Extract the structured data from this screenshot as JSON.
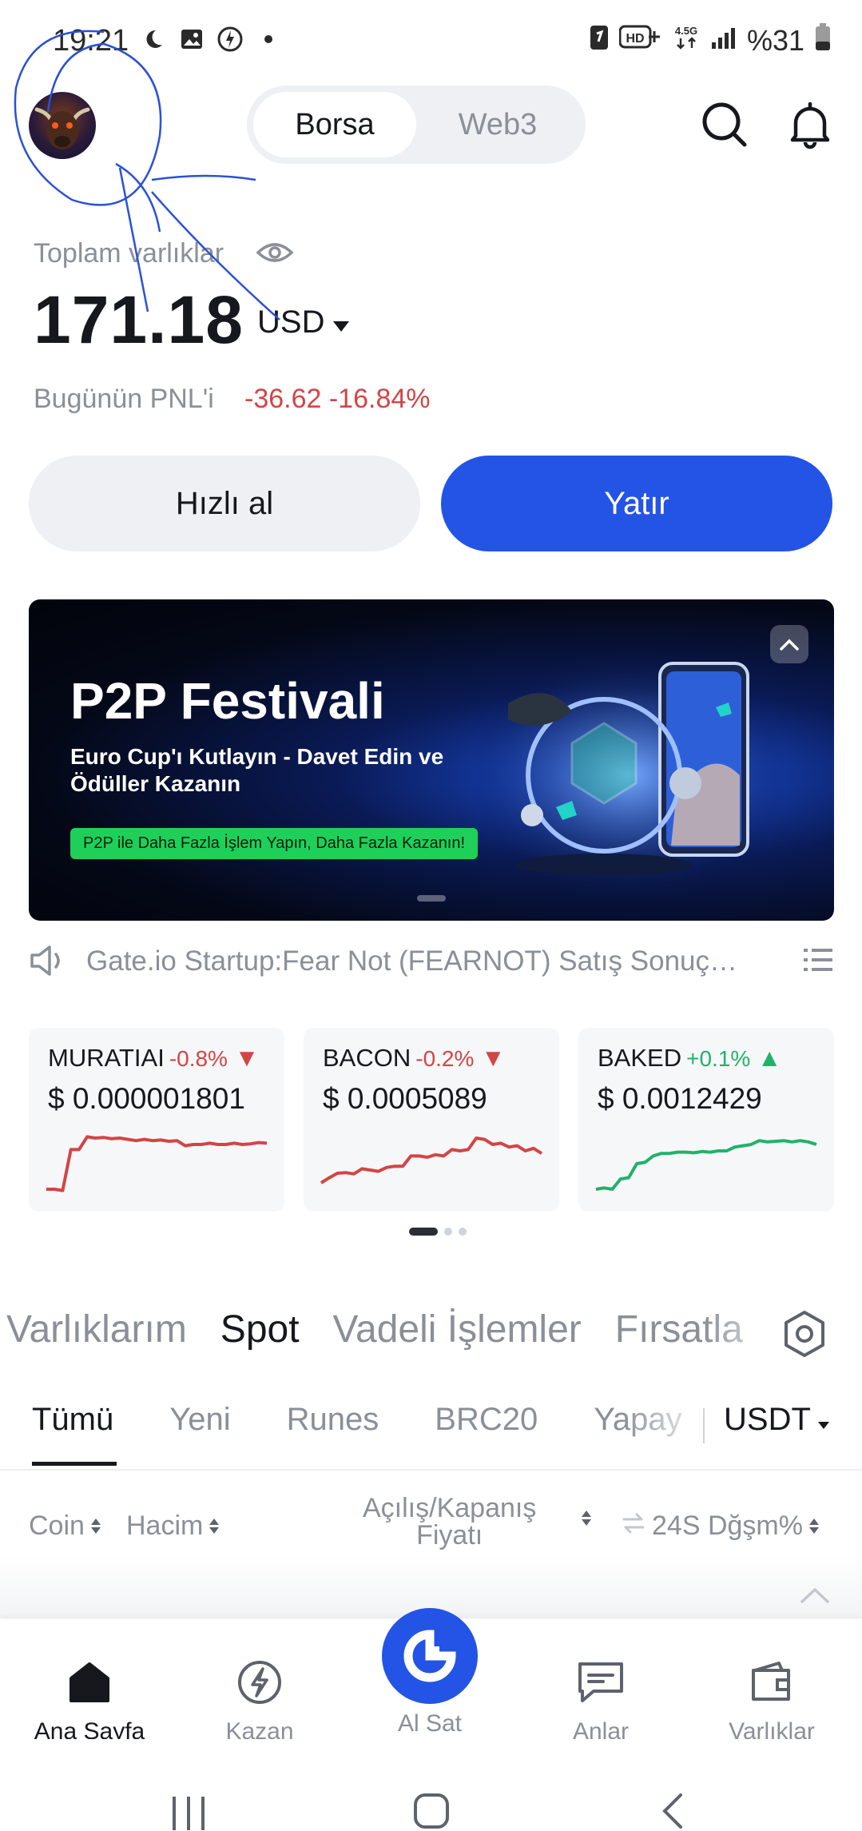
{
  "status_bar": {
    "time": "19:21",
    "battery": "%31"
  },
  "header": {
    "segments": [
      "Borsa",
      "Web3"
    ]
  },
  "assets": {
    "label": "Toplam varlıklar",
    "total": "171.18",
    "currency": "USD",
    "pnl_label": "Bugünün PNL'i",
    "pnl_value": "-36.62 -16.84%"
  },
  "actions": {
    "quick_buy": "Hızlı al",
    "deposit": "Yatır"
  },
  "banner": {
    "title": "P2P Festivali",
    "subtitle": "Euro Cup'ı Kutlayın - Davet Edin ve Ödüller Kazanın",
    "pill": "P2P ile Daha Fazla İşlem Yapın, Daha Fazla Kazanın!"
  },
  "announcement": {
    "text": "Gate.io Startup:Fear Not (FEARNOT) Satış Sonuç…"
  },
  "tickers": [
    {
      "name": "MURATIAI",
      "change": "-0.8%",
      "price": "$ 0.000001801",
      "trend": "down",
      "spark": [
        0.1,
        0.1,
        0.08,
        0.72,
        0.72,
        0.92,
        0.9,
        0.91,
        0.89,
        0.9,
        0.88,
        0.86,
        0.88,
        0.86,
        0.87,
        0.85,
        0.86,
        0.78,
        0.8,
        0.8,
        0.82,
        0.8,
        0.8,
        0.82,
        0.8,
        0.81,
        0.83,
        0.82
      ]
    },
    {
      "name": "BACON",
      "change": "-0.2%",
      "price": "$ 0.0005089",
      "trend": "down",
      "spark": [
        0.2,
        0.28,
        0.35,
        0.36,
        0.34,
        0.42,
        0.4,
        0.38,
        0.44,
        0.46,
        0.46,
        0.62,
        0.62,
        0.6,
        0.64,
        0.62,
        0.72,
        0.7,
        0.72,
        0.9,
        0.88,
        0.8,
        0.82,
        0.76,
        0.78,
        0.7,
        0.74,
        0.66
      ]
    },
    {
      "name": "BAKED",
      "change": "+0.1%",
      "price": "$ 0.0012429",
      "trend": "up",
      "spark": [
        0.1,
        0.12,
        0.1,
        0.26,
        0.28,
        0.5,
        0.52,
        0.62,
        0.66,
        0.66,
        0.68,
        0.68,
        0.67,
        0.69,
        0.68,
        0.7,
        0.7,
        0.76,
        0.78,
        0.8,
        0.86,
        0.84,
        0.85,
        0.86,
        0.84,
        0.86,
        0.84,
        0.8
      ]
    }
  ],
  "market_tabs": [
    "Varlıklarım",
    "Spot",
    "Vadeli İşlemler",
    "Fırsatla"
  ],
  "sub_tabs": [
    "Tümü",
    "Yeni",
    "Runes",
    "BRC20",
    "Yapay"
  ],
  "quote_currency": "USDT",
  "columns": {
    "coin": "Coin",
    "volume": "Hacim",
    "open_close_1": "Açılış/Kapanış",
    "open_close_2": "Fiyatı",
    "change": "24S Dğşm%"
  },
  "bottom_nav": {
    "home": "Ana Sayfa",
    "earn": "Kazan",
    "trade": "Al Sat",
    "moments": "Anlar",
    "assets": "Varlıklar"
  },
  "colors": {
    "accent": "#2354e6",
    "negative": "#d24545",
    "positive": "#21b26a"
  }
}
